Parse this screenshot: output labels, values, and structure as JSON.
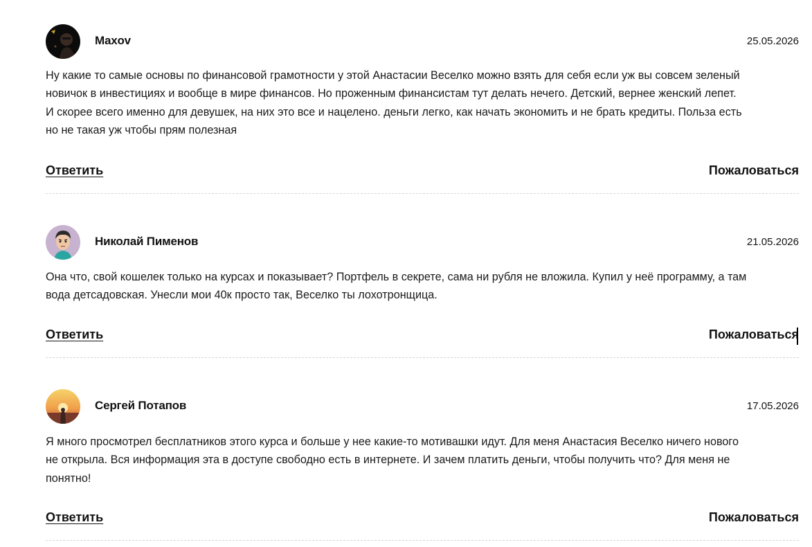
{
  "comments": [
    {
      "author": "Maxov",
      "date": "25.05.2026",
      "avatar_icon": "dark-portrait-avatar",
      "text_lines": [
        "Ну какие то самые основы по финансовой грамотности у этой Анастасии Веселко можно взять для себя если уж вы совсем зеленый",
        "новичок в инвестициях и вообще в мире финансов. Но проженным финансистам тут делать нечего. Детский, вернее женский лепет.",
        "И скорее всего именно для девушек, на них это все и нацелено. деньги легко, как начать экономить и не брать кредиты. Польза есть",
        "но не такая уж чтобы прям полезная"
      ],
      "reply_label": "Ответить",
      "complain_label": "Пожаловаться"
    },
    {
      "author": "Николай Пименов",
      "date": "21.05.2026",
      "avatar_icon": "cartoon-boy-avatar",
      "text_lines": [
        "Она что, свой кошелек только на курсах и показывает? Портфель в секрете, сама ни рубля не вложила. Купил у неё программу, а там",
        "вода детсадовская. Унесли мои 40к просто так, Веселко ты лохотронщица."
      ],
      "reply_label": "Ответить",
      "complain_label": "Пожаловаться"
    },
    {
      "author": "Сергей Потапов",
      "date": "17.05.2026",
      "avatar_icon": "sunset-photo-avatar",
      "text_lines": [
        "Я много просмотрел бесплатников этого курса и больше у нее какие-то мотивашки идут. Для меня Анастасия Веселко ничего нового",
        "не открыла. Вся информация эта в доступе свободно есть в интернете. И зачем платить деньги, чтобы получить что? Для меня не",
        "понятно!"
      ],
      "reply_label": "Ответить",
      "complain_label": "Пожаловаться"
    }
  ]
}
